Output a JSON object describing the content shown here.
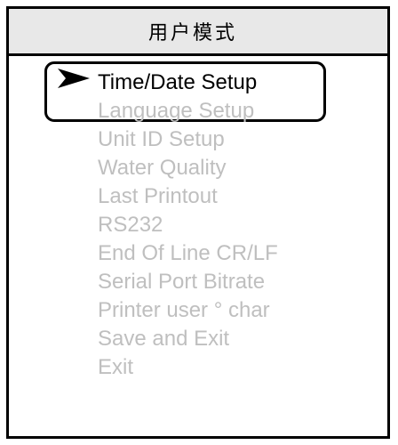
{
  "header": {
    "title": "用户模式"
  },
  "menu": {
    "selected_index": 0,
    "items": [
      {
        "label": "Time/Date Setup"
      },
      {
        "label": "Language Setup"
      },
      {
        "label": "Unit ID Setup"
      },
      {
        "label": "Water Quality"
      },
      {
        "label": "Last Printout"
      },
      {
        "label": "RS232"
      },
      {
        "label": "End Of Line CR/LF"
      },
      {
        "label": "Serial Port Bitrate"
      },
      {
        "label": "Printer user ° char"
      },
      {
        "label": "Save and Exit"
      },
      {
        "label": "Exit"
      }
    ]
  },
  "colors": {
    "selected_text": "#000000",
    "unselected_text": "#bfbfbf",
    "header_background": "#e8e8e8",
    "border": "#000000"
  },
  "icons": {
    "pointer": "arrow-pointer-icon"
  }
}
